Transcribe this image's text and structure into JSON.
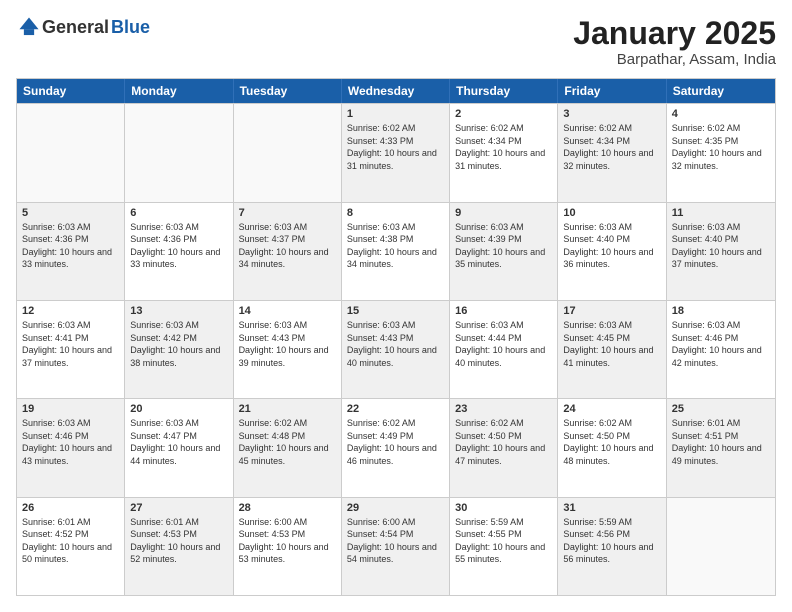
{
  "header": {
    "logo_general": "General",
    "logo_blue": "Blue",
    "month": "January 2025",
    "location": "Barpathar, Assam, India"
  },
  "days_of_week": [
    "Sunday",
    "Monday",
    "Tuesday",
    "Wednesday",
    "Thursday",
    "Friday",
    "Saturday"
  ],
  "rows": [
    [
      {
        "day": "",
        "text": "",
        "empty": true
      },
      {
        "day": "",
        "text": "",
        "empty": true
      },
      {
        "day": "",
        "text": "",
        "empty": true
      },
      {
        "day": "1",
        "text": "Sunrise: 6:02 AM\nSunset: 4:33 PM\nDaylight: 10 hours\nand 31 minutes.",
        "shaded": true
      },
      {
        "day": "2",
        "text": "Sunrise: 6:02 AM\nSunset: 4:34 PM\nDaylight: 10 hours\nand 31 minutes.",
        "shaded": false
      },
      {
        "day": "3",
        "text": "Sunrise: 6:02 AM\nSunset: 4:34 PM\nDaylight: 10 hours\nand 32 minutes.",
        "shaded": true
      },
      {
        "day": "4",
        "text": "Sunrise: 6:02 AM\nSunset: 4:35 PM\nDaylight: 10 hours\nand 32 minutes.",
        "shaded": false
      }
    ],
    [
      {
        "day": "5",
        "text": "Sunrise: 6:03 AM\nSunset: 4:36 PM\nDaylight: 10 hours\nand 33 minutes.",
        "shaded": true
      },
      {
        "day": "6",
        "text": "Sunrise: 6:03 AM\nSunset: 4:36 PM\nDaylight: 10 hours\nand 33 minutes.",
        "shaded": false
      },
      {
        "day": "7",
        "text": "Sunrise: 6:03 AM\nSunset: 4:37 PM\nDaylight: 10 hours\nand 34 minutes.",
        "shaded": true
      },
      {
        "day": "8",
        "text": "Sunrise: 6:03 AM\nSunset: 4:38 PM\nDaylight: 10 hours\nand 34 minutes.",
        "shaded": false
      },
      {
        "day": "9",
        "text": "Sunrise: 6:03 AM\nSunset: 4:39 PM\nDaylight: 10 hours\nand 35 minutes.",
        "shaded": true
      },
      {
        "day": "10",
        "text": "Sunrise: 6:03 AM\nSunset: 4:40 PM\nDaylight: 10 hours\nand 36 minutes.",
        "shaded": false
      },
      {
        "day": "11",
        "text": "Sunrise: 6:03 AM\nSunset: 4:40 PM\nDaylight: 10 hours\nand 37 minutes.",
        "shaded": true
      }
    ],
    [
      {
        "day": "12",
        "text": "Sunrise: 6:03 AM\nSunset: 4:41 PM\nDaylight: 10 hours\nand 37 minutes.",
        "shaded": false
      },
      {
        "day": "13",
        "text": "Sunrise: 6:03 AM\nSunset: 4:42 PM\nDaylight: 10 hours\nand 38 minutes.",
        "shaded": true
      },
      {
        "day": "14",
        "text": "Sunrise: 6:03 AM\nSunset: 4:43 PM\nDaylight: 10 hours\nand 39 minutes.",
        "shaded": false
      },
      {
        "day": "15",
        "text": "Sunrise: 6:03 AM\nSunset: 4:43 PM\nDaylight: 10 hours\nand 40 minutes.",
        "shaded": true
      },
      {
        "day": "16",
        "text": "Sunrise: 6:03 AM\nSunset: 4:44 PM\nDaylight: 10 hours\nand 40 minutes.",
        "shaded": false
      },
      {
        "day": "17",
        "text": "Sunrise: 6:03 AM\nSunset: 4:45 PM\nDaylight: 10 hours\nand 41 minutes.",
        "shaded": true
      },
      {
        "day": "18",
        "text": "Sunrise: 6:03 AM\nSunset: 4:46 PM\nDaylight: 10 hours\nand 42 minutes.",
        "shaded": false
      }
    ],
    [
      {
        "day": "19",
        "text": "Sunrise: 6:03 AM\nSunset: 4:46 PM\nDaylight: 10 hours\nand 43 minutes.",
        "shaded": true
      },
      {
        "day": "20",
        "text": "Sunrise: 6:03 AM\nSunset: 4:47 PM\nDaylight: 10 hours\nand 44 minutes.",
        "shaded": false
      },
      {
        "day": "21",
        "text": "Sunrise: 6:02 AM\nSunset: 4:48 PM\nDaylight: 10 hours\nand 45 minutes.",
        "shaded": true
      },
      {
        "day": "22",
        "text": "Sunrise: 6:02 AM\nSunset: 4:49 PM\nDaylight: 10 hours\nand 46 minutes.",
        "shaded": false
      },
      {
        "day": "23",
        "text": "Sunrise: 6:02 AM\nSunset: 4:50 PM\nDaylight: 10 hours\nand 47 minutes.",
        "shaded": true
      },
      {
        "day": "24",
        "text": "Sunrise: 6:02 AM\nSunset: 4:50 PM\nDaylight: 10 hours\nand 48 minutes.",
        "shaded": false
      },
      {
        "day": "25",
        "text": "Sunrise: 6:01 AM\nSunset: 4:51 PM\nDaylight: 10 hours\nand 49 minutes.",
        "shaded": true
      }
    ],
    [
      {
        "day": "26",
        "text": "Sunrise: 6:01 AM\nSunset: 4:52 PM\nDaylight: 10 hours\nand 50 minutes.",
        "shaded": false
      },
      {
        "day": "27",
        "text": "Sunrise: 6:01 AM\nSunset: 4:53 PM\nDaylight: 10 hours\nand 52 minutes.",
        "shaded": true
      },
      {
        "day": "28",
        "text": "Sunrise: 6:00 AM\nSunset: 4:53 PM\nDaylight: 10 hours\nand 53 minutes.",
        "shaded": false
      },
      {
        "day": "29",
        "text": "Sunrise: 6:00 AM\nSunset: 4:54 PM\nDaylight: 10 hours\nand 54 minutes.",
        "shaded": true
      },
      {
        "day": "30",
        "text": "Sunrise: 5:59 AM\nSunset: 4:55 PM\nDaylight: 10 hours\nand 55 minutes.",
        "shaded": false
      },
      {
        "day": "31",
        "text": "Sunrise: 5:59 AM\nSunset: 4:56 PM\nDaylight: 10 hours\nand 56 minutes.",
        "shaded": true
      },
      {
        "day": "",
        "text": "",
        "empty": true
      }
    ]
  ]
}
